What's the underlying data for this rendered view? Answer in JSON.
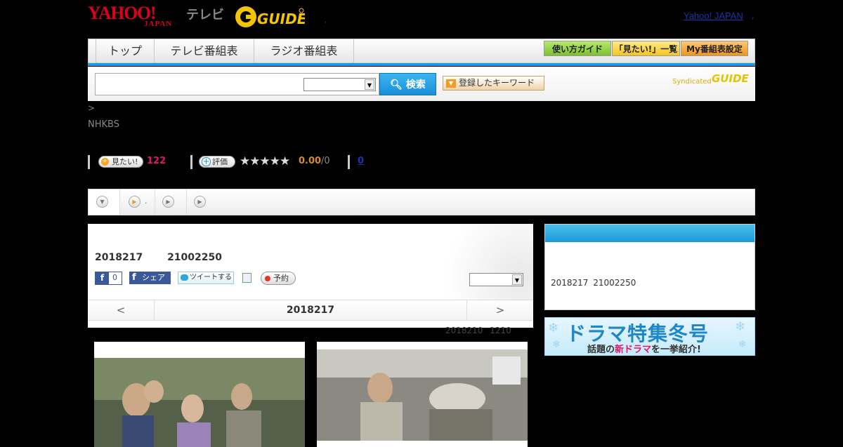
{
  "header": {
    "yahoo_logo": "YAHOO!",
    "yahoo_sub": "JAPAN",
    "tv_label": "テレビ",
    "gguide_logo": "G-GUIDE",
    "yahoo_japan_link": "Yahoo! JAPAN",
    "dot_a": ",",
    "dot_b": ","
  },
  "nav": {
    "tabs": [
      {
        "label": "トップ"
      },
      {
        "label": "テレビ番組表"
      },
      {
        "label": "ラジオ番組表"
      }
    ],
    "buttons": [
      {
        "label": "使い方ガイド",
        "color": "#8fd33a"
      },
      {
        "label": "「見たい!」一覧",
        "color": "#f5d23a"
      },
      {
        "label": "My番組表設定",
        "color": "#f2a12a"
      }
    ]
  },
  "search": {
    "placeholder": "",
    "button_label": "検索",
    "keyword_button": "登録したキーワード",
    "syndicated": "Syndicated",
    "syndicated_logo": "GUIDE"
  },
  "program": {
    "breadcrumb": ">",
    "channel": "NHKBS",
    "want_label": "見たい!",
    "want_count": "122",
    "rate_label": "評価",
    "stars": "★★★★★",
    "score": "0.00",
    "score_count": "/0",
    "comments": "0"
  },
  "main": {
    "date_line": "2018217 21002250",
    "fb_count": "0",
    "share_label": "シェア",
    "tweet_label": "ツイートする",
    "reserve_label": "予約",
    "day_prev": "<",
    "day_current": "2018217",
    "day_next": ">",
    "prev_air": "2018210 1210"
  },
  "side": {
    "text": "2018217 21002250"
  },
  "banner": {
    "title": "ドラマ特集冬号",
    "sub_pre": "話題の",
    "sub_hl": "新ドラマ",
    "sub_post": "を一挙紹介!"
  },
  "colors": {
    "accent_blue": "#1b9be0",
    "want_pink": "#e0176b",
    "score_orange": "#d88b2a"
  }
}
